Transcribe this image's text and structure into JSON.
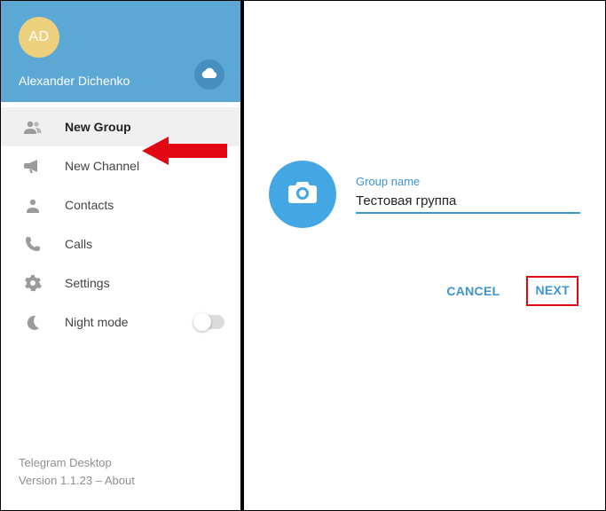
{
  "sidebar": {
    "avatar_initials": "AD",
    "user_name": "Alexander Dichenko",
    "items": [
      {
        "label": "New Group",
        "icon": "group-icon",
        "selected": true
      },
      {
        "label": "New Channel",
        "icon": "megaphone-icon",
        "selected": false
      },
      {
        "label": "Contacts",
        "icon": "contact-icon",
        "selected": false
      },
      {
        "label": "Calls",
        "icon": "phone-icon",
        "selected": false
      },
      {
        "label": "Settings",
        "icon": "gear-icon",
        "selected": false
      },
      {
        "label": "Night mode",
        "icon": "moon-icon",
        "selected": false,
        "toggle": true
      }
    ],
    "footer_app": "Telegram Desktop",
    "footer_version": "Version 1.1.23 – About"
  },
  "dialog": {
    "field_label": "Group name",
    "field_value": "Тестовая группа",
    "cancel_label": "CANCEL",
    "next_label": "NEXT"
  },
  "colors": {
    "accent": "#43a7e3",
    "header": "#5ca8d4",
    "annotation": "#e30613"
  }
}
